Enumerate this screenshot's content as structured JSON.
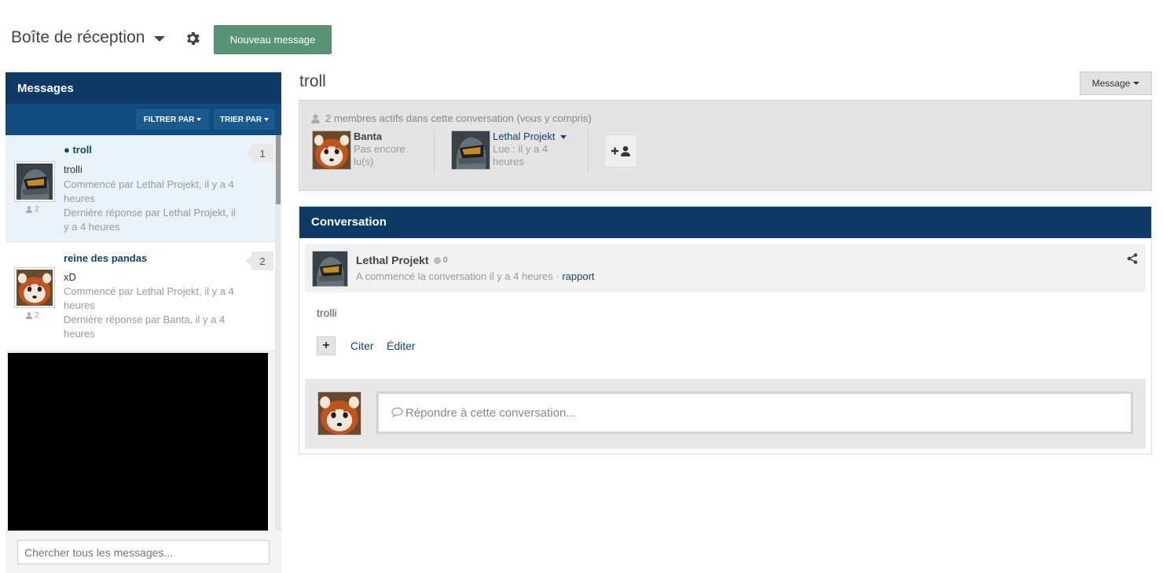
{
  "header": {
    "title": "Boîte de réception",
    "new_message_label": "Nouveau message"
  },
  "left_panel": {
    "title": "Messages",
    "filter_label": "FILTRER PAR",
    "sort_label": "TRIER PAR",
    "search_placeholder": "Chercher tous les messages...",
    "conversations": [
      {
        "title": "● troll",
        "excerpt": "trolli",
        "started": "Commencé par Lethal Projekt, il y a 4 heures",
        "last_reply": "Dernière réponse par Lethal Projekt, il y a 4 heures",
        "members": "2",
        "count": "1",
        "avatar": "spartan-helmet"
      },
      {
        "title": "reine des pandas",
        "excerpt": "xD",
        "started": "Commencé par Lethal Projekt, il y a 4 heures",
        "last_reply": "Dernière réponse par Banta, il y a 4 heures",
        "members": "2",
        "count": "2",
        "avatar": "red-panda"
      }
    ]
  },
  "conversation": {
    "title": "troll",
    "message_button": "Message",
    "members_heading": "2 membres actifs dans cette conversation (vous y compris)",
    "members": [
      {
        "name": "Banta",
        "status": "Pas encore lu(s)",
        "avatar": "red-panda"
      },
      {
        "name": "Lethal Projekt",
        "status": "Lue : il y a 4 heures",
        "avatar": "spartan-helmet"
      }
    ],
    "panel_title": "Conversation",
    "post": {
      "author": "Lethal Projekt",
      "reputation": "0",
      "meta": "A commencé la conversation il y a 4 heures",
      "separator": "·",
      "report_label": "rapport",
      "body": "trolli",
      "quote_label": "Citer",
      "edit_label": "Éditer"
    },
    "reply_placeholder": "Répondre à cette conversation..."
  },
  "colors": {
    "navy": "#0d3b66",
    "navy_light": "#104c7e",
    "green_button": "#5a9477",
    "link": "#12436c"
  }
}
